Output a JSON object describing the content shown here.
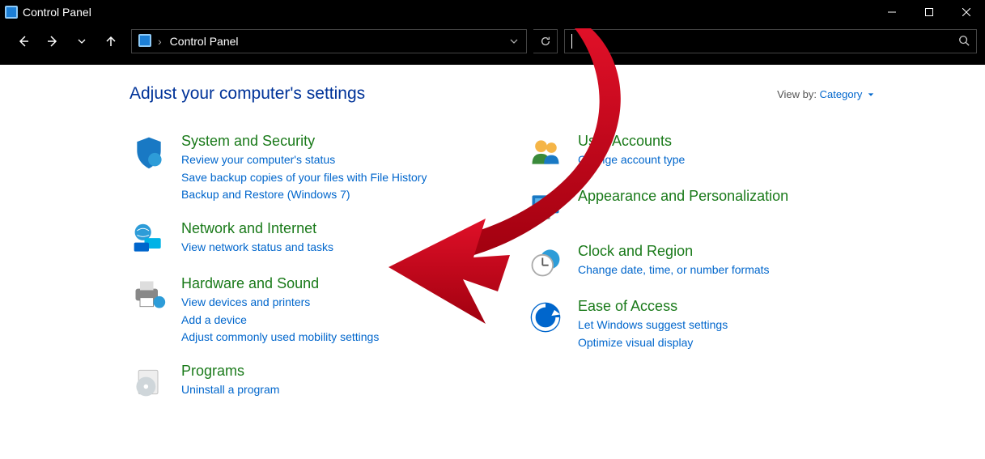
{
  "window": {
    "title": "Control Panel"
  },
  "address": {
    "path": "Control Panel",
    "chevron": "›"
  },
  "search": {
    "placeholder": ""
  },
  "header": {
    "title": "Adjust your computer's settings",
    "viewby_label": "View by:",
    "viewby_value": "Category"
  },
  "left": [
    {
      "title": "System and Security",
      "links": [
        "Review your computer's status",
        "Save backup copies of your files with File History",
        "Backup and Restore (Windows 7)"
      ]
    },
    {
      "title": "Network and Internet",
      "links": [
        "View network status and tasks"
      ]
    },
    {
      "title": "Hardware and Sound",
      "links": [
        "View devices and printers",
        "Add a device",
        "Adjust commonly used mobility settings"
      ]
    },
    {
      "title": "Programs",
      "links": [
        "Uninstall a program"
      ]
    }
  ],
  "right": [
    {
      "title": "User Accounts",
      "links": [
        "Change account type"
      ]
    },
    {
      "title": "Appearance and Personalization",
      "links": []
    },
    {
      "title": "Clock and Region",
      "links": [
        "Change date, time, or number formats"
      ]
    },
    {
      "title": "Ease of Access",
      "links": [
        "Let Windows suggest settings",
        "Optimize visual display"
      ]
    }
  ],
  "annotation": {
    "color": "#c4091c",
    "meaning": "red-arrow-pointing-to-view-network-status-and-tasks"
  }
}
